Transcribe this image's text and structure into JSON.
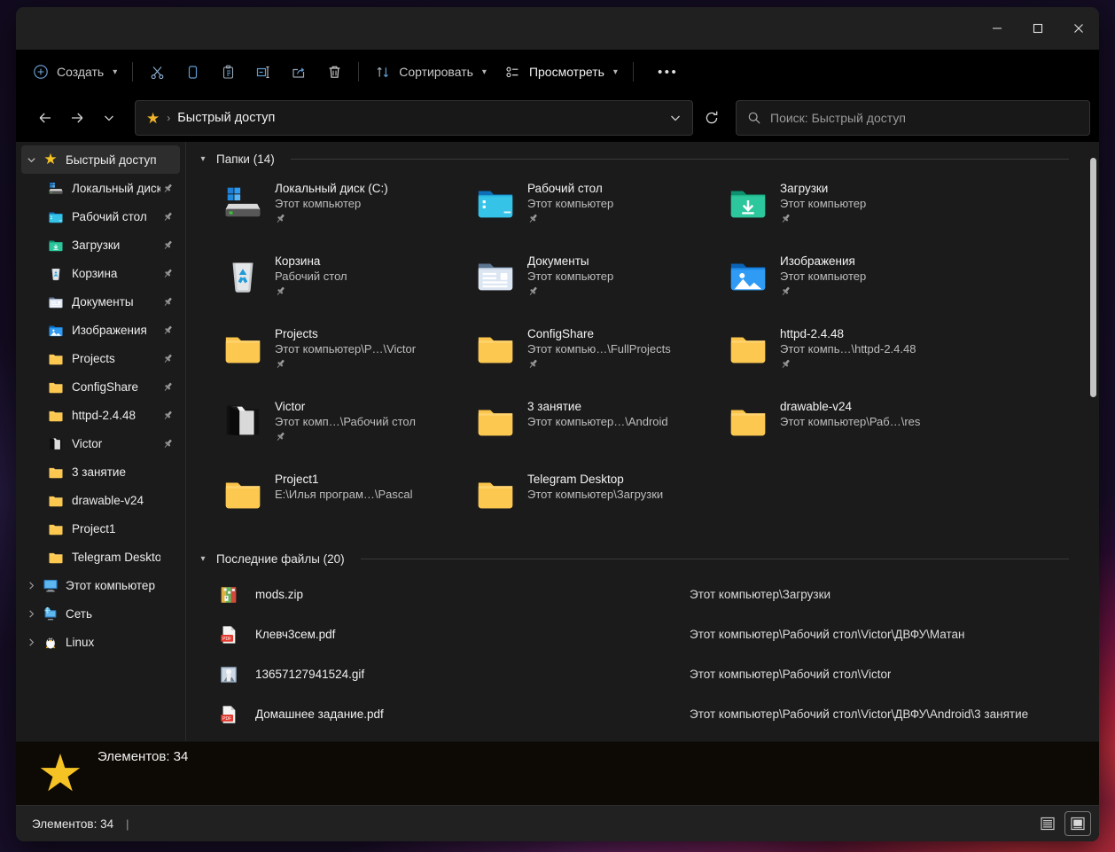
{
  "window": {
    "controls": [
      {
        "name": "minimize",
        "glyph": "minimize-icon"
      },
      {
        "name": "maximize",
        "glyph": "maximize-icon"
      },
      {
        "name": "close",
        "glyph": "close-icon"
      }
    ]
  },
  "toolbar": {
    "new_label": "Создать",
    "sort_label": "Сортировать",
    "view_label": "Просмотреть",
    "more_label": "•••",
    "icons": [
      "cut-icon",
      "copy-icon",
      "paste-icon",
      "rename-icon",
      "share-icon",
      "delete-icon"
    ]
  },
  "addressbar": {
    "crumb_icon": "star-icon",
    "crumb_separator": "›",
    "crumb_text": "Быстрый доступ",
    "dropdown_icon": "chevron-down-icon",
    "refresh_icon": "refresh-icon"
  },
  "search": {
    "placeholder": "Поиск: Быстрый доступ",
    "icon": "search-icon"
  },
  "nav": {
    "back_icon": "arrow-left-icon",
    "forward_icon": "arrow-right-icon",
    "recent_icon": "chevron-down-icon"
  },
  "sidebar": {
    "items": [
      {
        "label": "Быстрый доступ",
        "icon": "star-icon",
        "expander": "chevron-down",
        "selected": true,
        "pinned": false,
        "indent": false
      },
      {
        "label": "Локальный диск",
        "icon": "drive-icon",
        "expander": "",
        "selected": false,
        "pinned": true,
        "indent": true
      },
      {
        "label": "Рабочий стол",
        "icon": "desktop-folder-icon",
        "expander": "",
        "selected": false,
        "pinned": true,
        "indent": true
      },
      {
        "label": "Загрузки",
        "icon": "downloads-icon",
        "expander": "",
        "selected": false,
        "pinned": true,
        "indent": true
      },
      {
        "label": "Корзина",
        "icon": "recycle-bin-icon",
        "expander": "",
        "selected": false,
        "pinned": true,
        "indent": true
      },
      {
        "label": "Документы",
        "icon": "documents-icon",
        "expander": "",
        "selected": false,
        "pinned": true,
        "indent": true
      },
      {
        "label": "Изображения",
        "icon": "pictures-icon",
        "expander": "",
        "selected": false,
        "pinned": true,
        "indent": true
      },
      {
        "label": "Projects",
        "icon": "folder-icon",
        "expander": "",
        "selected": false,
        "pinned": true,
        "indent": true
      },
      {
        "label": "ConfigShare",
        "icon": "folder-icon",
        "expander": "",
        "selected": false,
        "pinned": true,
        "indent": true
      },
      {
        "label": "httpd-2.4.48",
        "icon": "folder-icon",
        "expander": "",
        "selected": false,
        "pinned": true,
        "indent": true
      },
      {
        "label": "Victor",
        "icon": "dark-folder-icon",
        "expander": "",
        "selected": false,
        "pinned": true,
        "indent": true
      },
      {
        "label": "3 занятие",
        "icon": "folder-icon",
        "expander": "",
        "selected": false,
        "pinned": false,
        "indent": true
      },
      {
        "label": "drawable-v24",
        "icon": "folder-icon",
        "expander": "",
        "selected": false,
        "pinned": false,
        "indent": true
      },
      {
        "label": "Project1",
        "icon": "folder-icon",
        "expander": "",
        "selected": false,
        "pinned": false,
        "indent": true
      },
      {
        "label": "Telegram Desktop",
        "icon": "folder-icon",
        "expander": "",
        "selected": false,
        "pinned": false,
        "indent": true
      },
      {
        "label": "Этот компьютер",
        "icon": "this-pc-icon",
        "expander": "chevron-right",
        "selected": false,
        "pinned": false,
        "indent": false
      },
      {
        "label": "Сеть",
        "icon": "network-icon",
        "expander": "chevron-right",
        "selected": false,
        "pinned": false,
        "indent": false
      },
      {
        "label": "Linux",
        "icon": "linux-penguin-icon",
        "expander": "chevron-right",
        "selected": false,
        "pinned": false,
        "indent": false
      }
    ]
  },
  "folders_section": {
    "title": "Папки (14)",
    "collapse_icon": "chevron-down-icon",
    "items": [
      {
        "name": "Локальный диск (C:)",
        "path": "Этот компьютер",
        "icon": "drive-icon",
        "pinned": true
      },
      {
        "name": "Рабочий стол",
        "path": "Этот компьютер",
        "icon": "desktop-folder-icon",
        "pinned": true
      },
      {
        "name": "Загрузки",
        "path": "Этот компьютер",
        "icon": "downloads-icon",
        "pinned": true
      },
      {
        "name": "Корзина",
        "path": "Рабочий стол",
        "icon": "recycle-bin-icon",
        "pinned": true
      },
      {
        "name": "Документы",
        "path": "Этот компьютер",
        "icon": "documents-icon",
        "pinned": true
      },
      {
        "name": "Изображения",
        "path": "Этот компьютер",
        "icon": "pictures-icon",
        "pinned": true
      },
      {
        "name": "Projects",
        "path": "Этот компьютер\\P…\\Victor",
        "icon": "folder-icon",
        "pinned": true
      },
      {
        "name": "ConfigShare",
        "path": "Этот компью…\\FullProjects",
        "icon": "folder-icon",
        "pinned": true
      },
      {
        "name": "httpd-2.4.48",
        "path": "Этот компь…\\httpd-2.4.48",
        "icon": "folder-icon",
        "pinned": true
      },
      {
        "name": "Victor",
        "path": "Этот комп…\\Рабочий стол",
        "icon": "dark-folder-icon",
        "pinned": true
      },
      {
        "name": "3 занятие",
        "path": "Этот компьютер…\\Android",
        "icon": "folder-icon",
        "pinned": false
      },
      {
        "name": "drawable-v24",
        "path": "Этот компьютер\\Раб…\\res",
        "icon": "folder-icon",
        "pinned": false
      },
      {
        "name": "Project1",
        "path": "E:\\Илья програм…\\Pascal",
        "icon": "folder-icon",
        "pinned": false
      },
      {
        "name": "Telegram Desktop",
        "path": "Этот компьютер\\Загрузки",
        "icon": "folder-icon",
        "pinned": false
      }
    ]
  },
  "recent_section": {
    "title": "Последние файлы (20)",
    "collapse_icon": "chevron-down-icon",
    "items": [
      {
        "name": "mods.zip",
        "path": "Этот компьютер\\Загрузки",
        "icon": "archive-icon"
      },
      {
        "name": "Клевч3сем.pdf",
        "path": "Этот компьютер\\Рабочий стол\\Victor\\ДВФУ\\Матан",
        "icon": "pdf-icon"
      },
      {
        "name": "13657127941524.gif",
        "path": "Этот компьютер\\Рабочий стол\\Victor",
        "icon": "image-icon"
      },
      {
        "name": "Домашнее задание.pdf",
        "path": "Этот компьютер\\Рабочий стол\\Victor\\ДВФУ\\Android\\3 занятие",
        "icon": "pdf-icon"
      }
    ]
  },
  "tooltip": {
    "icon": "star-icon",
    "text": "Элементов: 34"
  },
  "statusbar": {
    "text": "Элементов: 34",
    "separator": "|",
    "views": [
      {
        "name": "details-view",
        "icon": "list-view-icon",
        "active": false
      },
      {
        "name": "large-icons-view",
        "icon": "tiles-view-icon",
        "active": true
      }
    ]
  },
  "colors": {
    "accent_star": "#f6c324",
    "folder_yellow": "#f7bb3d",
    "window_bg": "#1b1b1b",
    "toolbar_bg": "#000000"
  }
}
